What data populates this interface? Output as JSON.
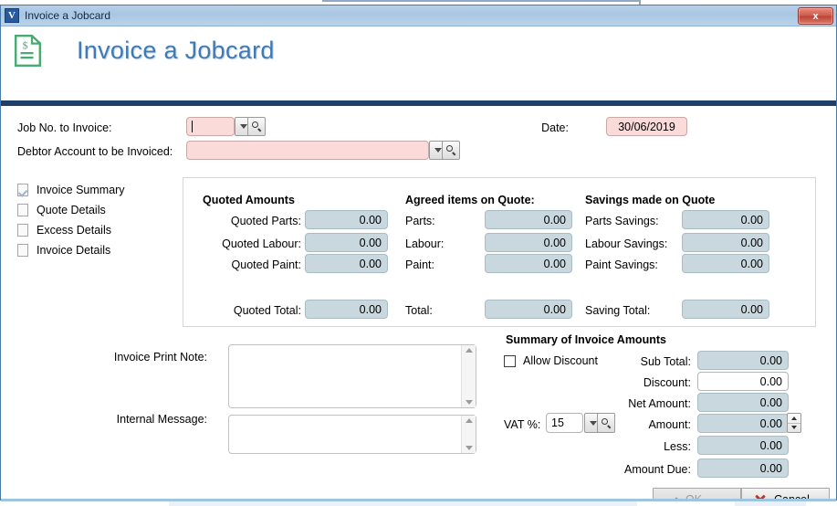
{
  "window": {
    "title": "Invoice a Jobcard",
    "app_icon": "v-logo-icon",
    "close_label": "x"
  },
  "header": {
    "icon": "invoice-document-icon",
    "title": "Invoice a Jobcard"
  },
  "top_form": {
    "job_no_label": "Job No. to Invoice:",
    "job_no_value": "",
    "debtor_label": "Debtor Account to be Invoiced:",
    "debtor_value": "",
    "date_label": "Date:",
    "date_value": "30/06/2019"
  },
  "sidebar": {
    "items": [
      {
        "label": "Invoice Summary",
        "checked": true
      },
      {
        "label": "Quote Details",
        "checked": false
      },
      {
        "label": "Excess Details",
        "checked": false
      },
      {
        "label": "Invoice Details",
        "checked": false
      }
    ]
  },
  "amounts": {
    "quoted": {
      "heading": "Quoted Amounts",
      "rows": [
        {
          "label": "Quoted Parts:",
          "value": "0.00"
        },
        {
          "label": "Quoted Labour:",
          "value": "0.00"
        },
        {
          "label": "Quoted Paint:",
          "value": "0.00"
        }
      ],
      "total_label": "Quoted Total:",
      "total_value": "0.00"
    },
    "agreed": {
      "heading": "Agreed items on Quote:",
      "rows": [
        {
          "label": "Parts:",
          "value": "0.00"
        },
        {
          "label": "Labour:",
          "value": "0.00"
        },
        {
          "label": "Paint:",
          "value": "0.00"
        }
      ],
      "total_label": "Total:",
      "total_value": "0.00"
    },
    "savings": {
      "heading": "Savings made on Quote",
      "rows": [
        {
          "label": "Parts Savings:",
          "value": "0.00"
        },
        {
          "label": "Labour Savings:",
          "value": "0.00"
        },
        {
          "label": "Paint Savings:",
          "value": "0.00"
        }
      ],
      "total_label": "Saving Total:",
      "total_value": "0.00"
    }
  },
  "notes": {
    "print_note_label": "Invoice Print Note:",
    "print_note_value": "",
    "internal_label": "Internal Message:",
    "internal_value": ""
  },
  "summary": {
    "heading": "Summary of Invoice Amounts",
    "allow_discount_label": "Allow Discount",
    "allow_discount_checked": false,
    "vat_label": "VAT %:",
    "vat_value": "15",
    "rows": [
      {
        "label": "Sub Total:",
        "value": "0.00",
        "readonly": true
      },
      {
        "label": "Discount:",
        "value": "0.00",
        "readonly": false
      },
      {
        "label": "Net Amount:",
        "value": "0.00",
        "readonly": true
      },
      {
        "label": "Amount:",
        "value": "0.00",
        "readonly": true
      },
      {
        "label": "Less:",
        "value": "0.00",
        "readonly": true
      },
      {
        "label": "Amount Due:",
        "value": "0.00",
        "readonly": true
      }
    ]
  },
  "footer": {
    "ok_label": "OK",
    "ok_disabled": true,
    "cancel_label": "Cancel"
  },
  "colors": {
    "accent": "#3f7ab5",
    "header_rule": "#1f3f6b",
    "required_field": "#fbdada",
    "readonly_field": "#c8d8de",
    "icon_green": "#4aaa72"
  }
}
